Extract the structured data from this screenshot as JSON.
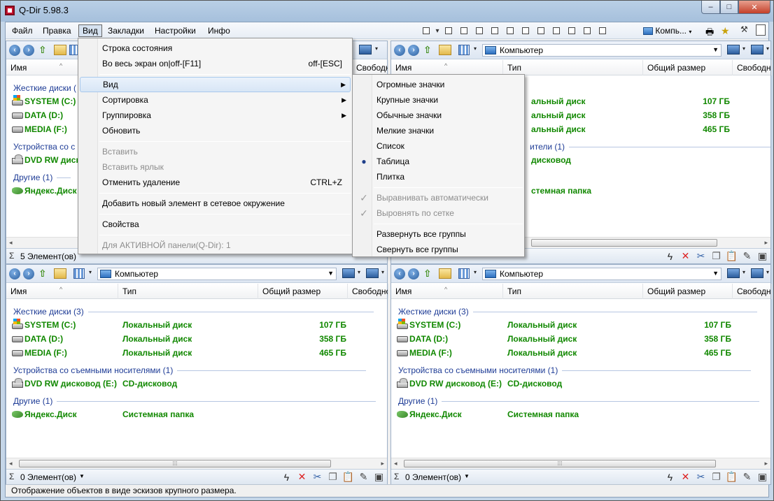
{
  "window": {
    "title": "Q-Dir 5.98.3",
    "min": "‒",
    "max": "□",
    "close": "✕"
  },
  "menubar": {
    "items": [
      "Файл",
      "Правка",
      "Вид",
      "Закладки",
      "Настройки",
      "Инфо"
    ],
    "toolbar_label": "Компь..."
  },
  "main_menu": {
    "items": [
      {
        "label": "Строка состояния",
        "accel": ""
      },
      {
        "label": "Во весь экран   on|off-[F11]",
        "accel": "off-[ESC]"
      },
      {
        "label": "Вид",
        "accel": ""
      },
      {
        "label": "Сортировка",
        "accel": ""
      },
      {
        "label": "Группировка",
        "accel": ""
      },
      {
        "label": "Обновить",
        "accel": ""
      },
      {
        "label": "Вставить",
        "accel": ""
      },
      {
        "label": "Вставить ярлык",
        "accel": ""
      },
      {
        "label": "Отменить удаление",
        "accel": "CTRL+Z"
      },
      {
        "label": "Добавить новый элемент в сетевое окружение",
        "accel": ""
      },
      {
        "label": "Свойства",
        "accel": ""
      },
      {
        "label": "Для АКТИВНОЙ панели(Q-Dir): 1",
        "accel": ""
      }
    ]
  },
  "view_submenu": {
    "items": [
      "Огромные значки",
      "Крупные значки",
      "Обычные значки",
      "Мелкие значки",
      "Список",
      "Таблица",
      "Плитка",
      "Выравнивать автоматически",
      "Выровнять по сетке",
      "Развернуть все группы",
      "Свернуть все группы"
    ],
    "selected": "Таблица"
  },
  "pane": {
    "address": "Компьютер",
    "columns": [
      "Имя",
      "Тип",
      "Общий размер",
      "Свободно"
    ],
    "groups": {
      "hdd": "Жесткие диски (3)",
      "hdd_short": "Жесткие диски (",
      "removable": "Устройства со съемными носителями (1)",
      "removable_short": "Устройства со с",
      "removable_tail": "ители (1)",
      "other": "Другие (1)"
    },
    "rows": {
      "sys_name": "SYSTEM (C:)",
      "sys_type": "Локальный диск",
      "sys_size": "107 ГБ",
      "data_name": "DATA (D:)",
      "data_type": "Локальный диск",
      "data_size": "358 ГБ",
      "media_name": "MEDIA (F:)",
      "media_type": "Локальный диск",
      "media_size": "465 ГБ",
      "dvd_name": "DVD RW дисковод (E:)",
      "dvd_name_short": "DVD RW дисков",
      "dvd_type": "CD-дисковод",
      "yd_name": "Яндекс.Диск",
      "yd_type": "Системная папка",
      "tail_local": "альный диск",
      "tail_dvd": "дисковод",
      "tail_sys": "стемная папка"
    },
    "status_5": "5 Элемент(ов)",
    "status_0": "0 Элемент(ов)"
  },
  "hint": "Отображение объектов в виде эскизов крупного размера."
}
